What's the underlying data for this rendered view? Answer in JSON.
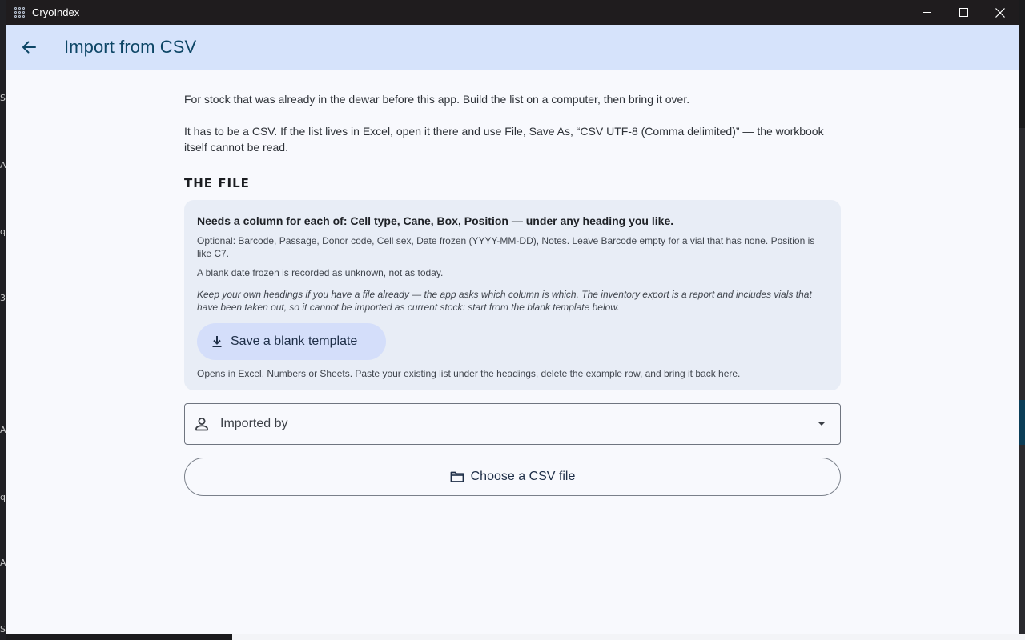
{
  "window": {
    "app_title": "CryoIndex",
    "controls": [
      "minimize-icon",
      "maximize-icon",
      "close-icon"
    ]
  },
  "appbar": {
    "title": "Import from CSV",
    "back_icon": "arrow-left-icon"
  },
  "intro": {
    "line1": "For stock that was already in the dewar before this app. Build the list on a computer, then bring it over.",
    "line2": "It has to be a CSV. If the list lives in Excel, open it there and use File, Save As, “CSV UTF-8 (Comma delimited)” — the workbook itself cannot be read."
  },
  "file_section": {
    "heading": "THE FILE",
    "lead": "Needs a column for each of: Cell type, Cane, Box, Position — under any heading you like.",
    "optional": "Optional: Barcode, Passage, Donor code, Cell sex, Date frozen (YYYY-MM-DD), Notes. Leave Barcode empty for a vial that has none. Position is like C7.",
    "blank_date": "A blank date frozen is recorded as unknown, not as today.",
    "note": "Keep your own headings if you have a file already — the app asks which column is which. The inventory export is a report and includes vials that have been taken out, so it cannot be imported as current stock: start from the blank template below.",
    "template_button": "Save a blank template",
    "template_hint": "Opens in Excel, Numbers or Sheets. Paste your existing list under the headings, delete the example row, and bring it back here."
  },
  "imported_by": {
    "label": "Imported by",
    "icon": "person-icon"
  },
  "choose_button": {
    "label": "Choose a CSV file",
    "icon": "folder-icon"
  },
  "colors": {
    "appbar": "#d6e3fb",
    "title": "#0d4666",
    "card": "#e8edf6",
    "tonal_button": "#d4defa",
    "background": "#f8f9fd"
  }
}
